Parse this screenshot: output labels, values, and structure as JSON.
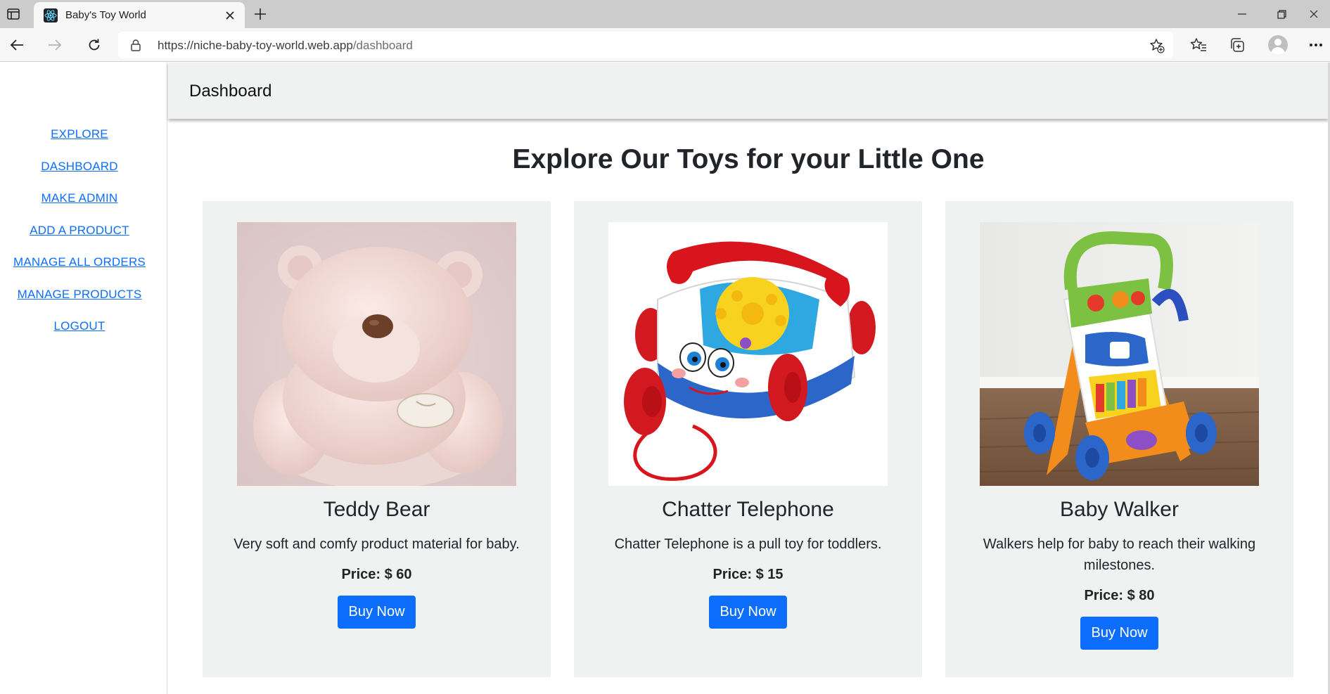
{
  "browser": {
    "tab_title": "Baby's Toy World",
    "url_host": "https://niche-baby-toy-world.web.app",
    "url_path": "/dashboard"
  },
  "sidebar": {
    "items": [
      {
        "label": "EXPLORE"
      },
      {
        "label": "DASHBOARD"
      },
      {
        "label": "MAKE ADMIN"
      },
      {
        "label": "ADD A PRODUCT"
      },
      {
        "label": "MANAGE ALL ORDERS"
      },
      {
        "label": "MANAGE PRODUCTS"
      },
      {
        "label": "LOGOUT"
      }
    ]
  },
  "header": {
    "title": "Dashboard"
  },
  "main": {
    "heading": "Explore Our Toys for your Little One",
    "products": [
      {
        "name": "Teddy Bear",
        "description": "Very soft and comfy product material for baby.",
        "price": "Price: $ 60",
        "button": "Buy Now"
      },
      {
        "name": "Chatter Telephone",
        "description": "Chatter Telephone is a pull toy for toddlers.",
        "price": "Price: $ 15",
        "button": "Buy Now"
      },
      {
        "name": "Baby Walker",
        "description": "Walkers help for baby to reach their walking milestones.",
        "price": "Price: $ 80",
        "button": "Buy Now"
      }
    ]
  },
  "colors": {
    "link": "#0d6efd",
    "button": "#0d6efd",
    "card_background": "#f0f1f1",
    "header_background": "#f0f1f1"
  },
  "icons": [
    "tab-actions-icon",
    "react-logo-icon",
    "close-icon",
    "plus-icon",
    "minimize-icon",
    "restore-icon",
    "window-close-icon",
    "back-arrow-icon",
    "forward-arrow-icon",
    "refresh-icon",
    "lock-icon",
    "add-favorite-icon",
    "favorites-icon",
    "collections-icon",
    "profile-icon",
    "more-icon"
  ]
}
